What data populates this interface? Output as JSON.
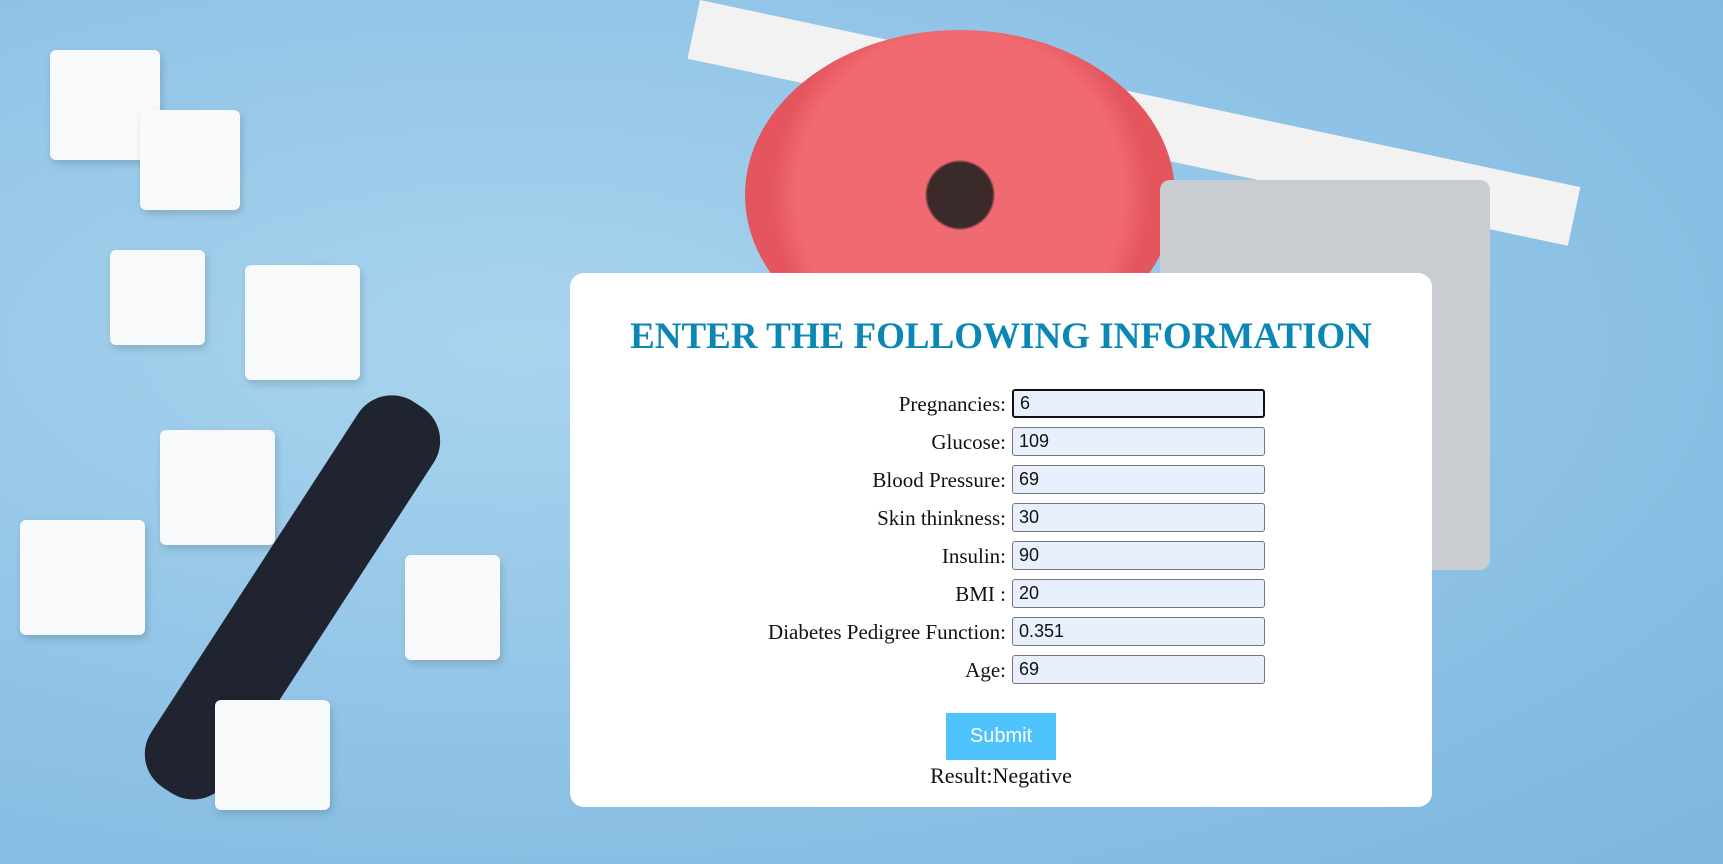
{
  "form": {
    "title": "ENTER THE FOLLOWING INFORMATION",
    "fields": [
      {
        "label": "Pregnancies:",
        "value": "6"
      },
      {
        "label": "Glucose:",
        "value": "109"
      },
      {
        "label": "Blood Pressure:",
        "value": "69"
      },
      {
        "label": "Skin thinkness:",
        "value": "30"
      },
      {
        "label": "Insulin:",
        "value": "90"
      },
      {
        "label": "BMI :",
        "value": "20"
      },
      {
        "label": "Diabetes Pedigree Function:",
        "value": "0.351"
      },
      {
        "label": "Age:",
        "value": "69"
      }
    ],
    "submit_label": "Submit",
    "result": "Result:Negative"
  },
  "colors": {
    "title": "#0a87b5",
    "submit": "#4fc3fc",
    "input_bg": "#e8f0fe"
  }
}
